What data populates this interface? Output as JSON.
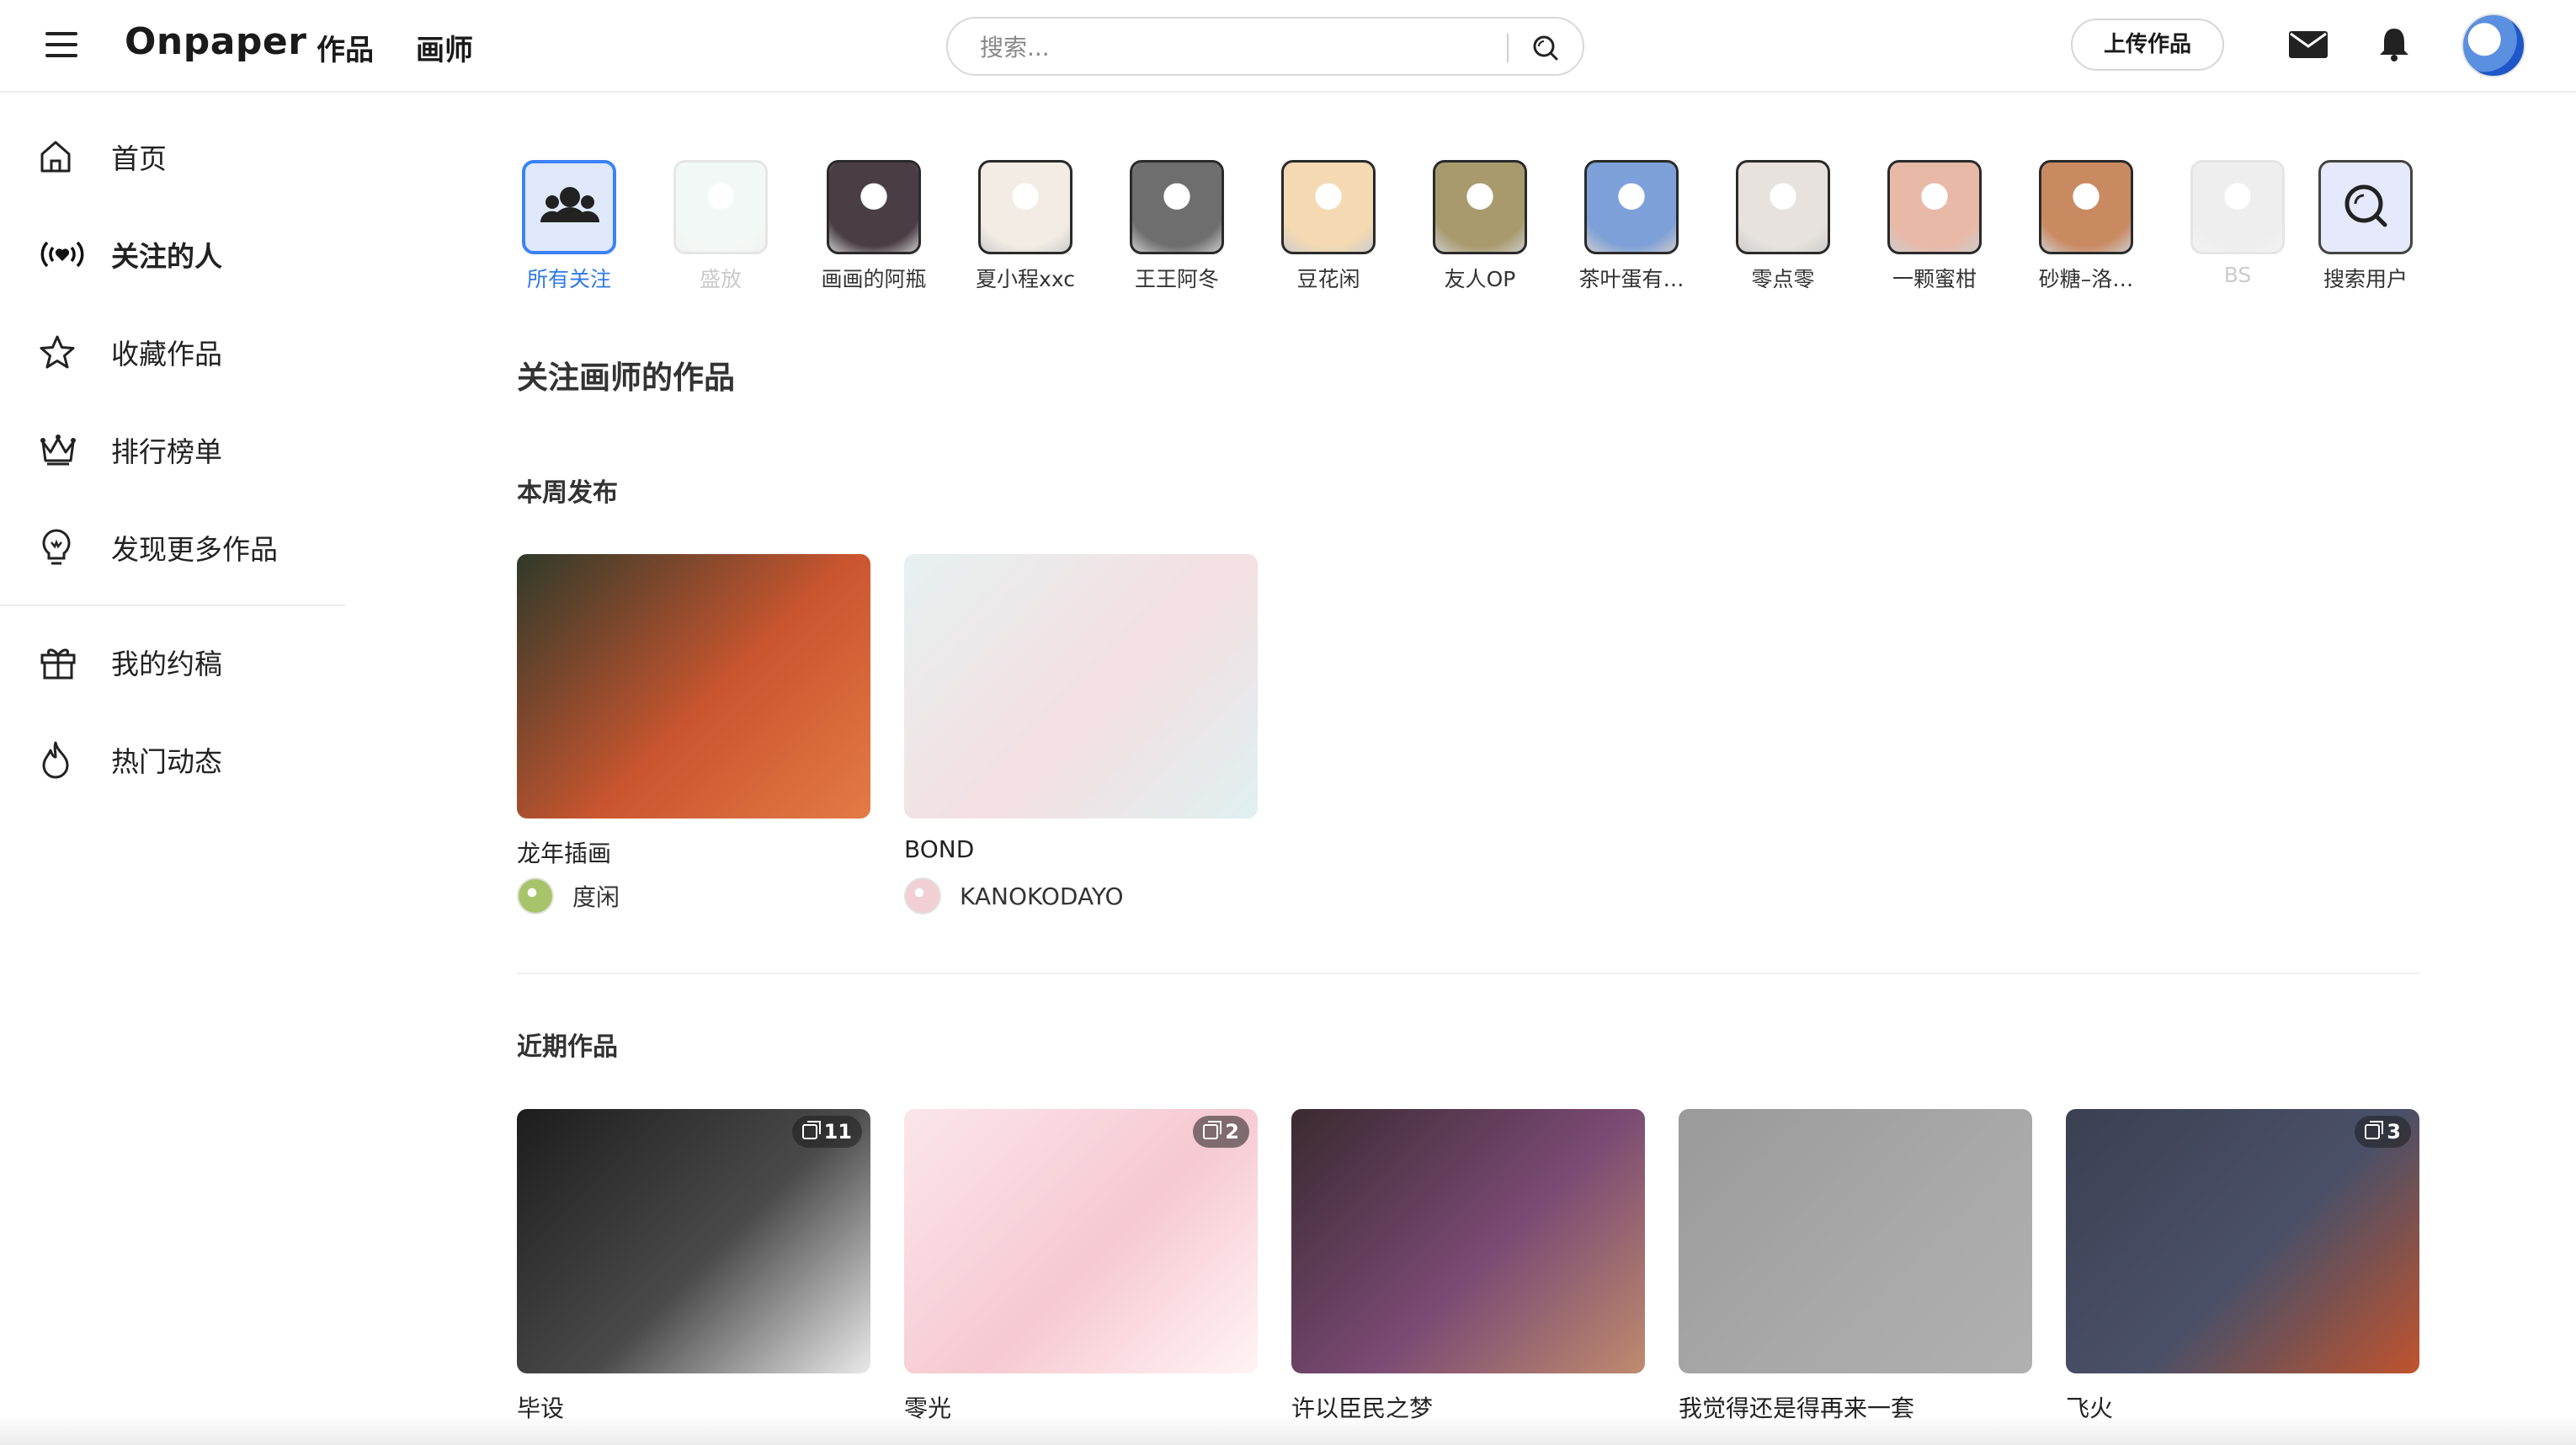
{
  "app": {
    "logo": "Onpaper"
  },
  "topnav": {
    "works": "作品",
    "artists": "画师"
  },
  "search": {
    "placeholder": "搜索..."
  },
  "header": {
    "upload_label": "上传作品"
  },
  "sidebar": {
    "items": [
      {
        "label": "首页",
        "icon": "home-icon"
      },
      {
        "label": "关注的人",
        "icon": "broadcast-heart-icon",
        "active": true
      },
      {
        "label": "收藏作品",
        "icon": "star-icon"
      },
      {
        "label": "排行榜单",
        "icon": "crown-icon"
      },
      {
        "label": "发现更多作品",
        "icon": "lightbulb-icon"
      },
      {
        "label": "我的约稿",
        "icon": "gift-icon"
      },
      {
        "label": "热门动态",
        "icon": "flame-icon"
      }
    ]
  },
  "following": {
    "items": [
      {
        "name": "所有关注",
        "selected": true,
        "color": "#dfe9fb"
      },
      {
        "name": "盛放",
        "faded": true,
        "color": "#cfe6d8"
      },
      {
        "name": "画画的阿瓶",
        "color": "#4a3e45"
      },
      {
        "name": "夏小程xxc",
        "color": "#f2ece4"
      },
      {
        "name": "王王阿冬",
        "color": "#6e6e6e"
      },
      {
        "name": "豆花闲",
        "color": "#f4d9b2"
      },
      {
        "name": "友人OP",
        "color": "#a89a6c"
      },
      {
        "name": "茶叶蛋有…",
        "color": "#7ea0d8"
      },
      {
        "name": "零点零",
        "color": "#e7e2dd"
      },
      {
        "name": "一颗蜜柑",
        "color": "#e9b9a7"
      },
      {
        "name": "砂糖–洛…",
        "color": "#c98a62"
      },
      {
        "name": "BS",
        "faded": true,
        "color": "#bdbdbd"
      }
    ],
    "search_users": "搜索用户"
  },
  "main": {
    "title": "关注画师的作品",
    "week": {
      "title": "本周发布",
      "cards": [
        {
          "title": "龙年插画",
          "author": "度闲",
          "colors": [
            "#2f3a2a",
            "#c9552f",
            "#e47a45"
          ],
          "author_color": "#a8c46a"
        },
        {
          "title": "BOND",
          "author": "KANOKODAYO",
          "colors": [
            "#e6f1f0",
            "#f4dfe2",
            "#dff0f1"
          ],
          "author_color": "#f1cfd5"
        }
      ]
    },
    "recent": {
      "title": "近期作品",
      "cards": [
        {
          "title": "毕设",
          "count": "11",
          "colors": [
            "#1d1d1d",
            "#4a4a4a",
            "#e9e9e9"
          ]
        },
        {
          "title": "零光",
          "count": "2",
          "colors": [
            "#fbe6ea",
            "#f6c9d2",
            "#fff4f4"
          ]
        },
        {
          "title": "许以臣民之梦",
          "count": "",
          "colors": [
            "#3a2a30",
            "#7a4a74",
            "#c08b6e"
          ]
        },
        {
          "title": "我觉得还是得再来一套",
          "count": "",
          "colors": [
            "#9a9a9a",
            "#a8a8a8",
            "#b0b0b0"
          ]
        },
        {
          "title": "飞火",
          "count": "3",
          "colors": [
            "#3b4052",
            "#4a5068",
            "#c0532d"
          ]
        }
      ]
    }
  }
}
